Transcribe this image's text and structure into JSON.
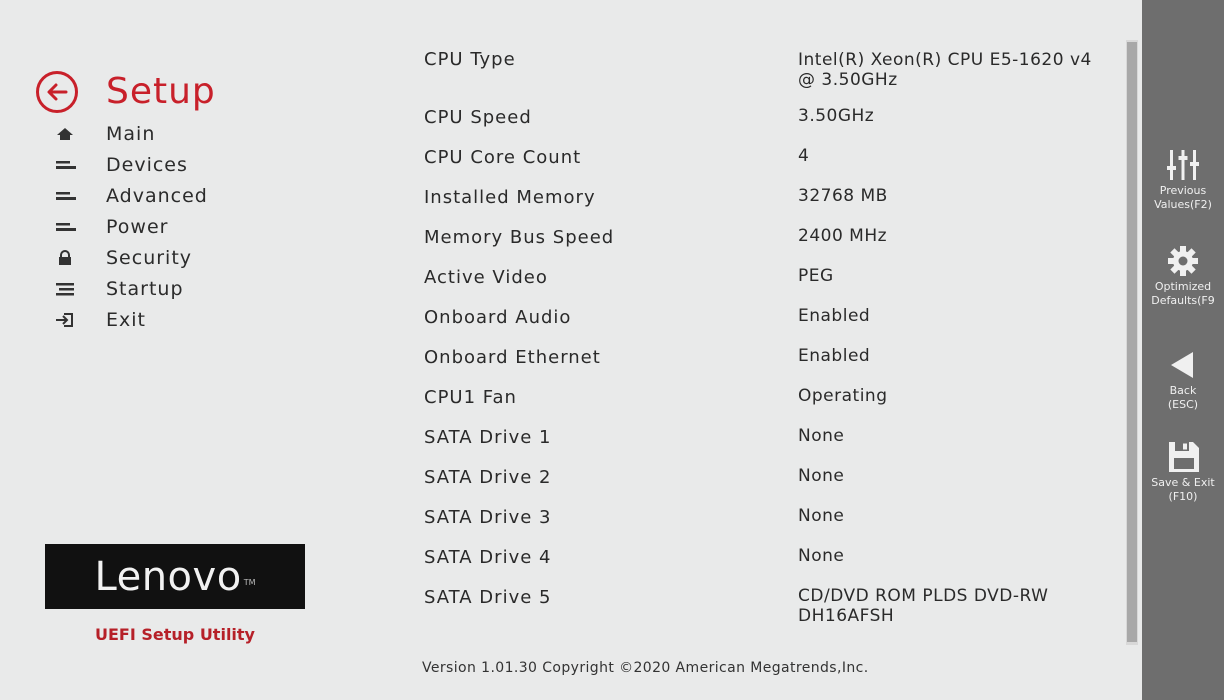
{
  "header": {
    "title": "Setup"
  },
  "nav": {
    "items": [
      {
        "label": "Main",
        "icon": "home-icon"
      },
      {
        "label": "Devices",
        "icon": "menu-lines-icon"
      },
      {
        "label": "Advanced",
        "icon": "menu-lines-icon"
      },
      {
        "label": "Power",
        "icon": "menu-lines-icon"
      },
      {
        "label": "Security",
        "icon": "lock-icon"
      },
      {
        "label": "Startup",
        "icon": "startup-icon"
      },
      {
        "label": "Exit",
        "icon": "exit-icon"
      }
    ]
  },
  "branding": {
    "logo": "Lenovo",
    "tm": "TM",
    "utility": "UEFI Setup Utility"
  },
  "info": {
    "rows": [
      {
        "key": "CPU Type",
        "value": "Intel(R) Xeon(R) CPU E5-1620 v4 @ 3.50GHz"
      },
      {
        "key": "CPU Speed",
        "value": "3.50GHz"
      },
      {
        "key": "CPU Core Count",
        "value": "4"
      },
      {
        "key": "Installed Memory",
        "value": "32768 MB"
      },
      {
        "key": "Memory Bus Speed",
        "value": "2400 MHz"
      },
      {
        "key": "Active Video",
        "value": "PEG"
      },
      {
        "key": "Onboard Audio",
        "value": "Enabled"
      },
      {
        "key": "Onboard Ethernet",
        "value": "Enabled"
      },
      {
        "key": "CPU1 Fan",
        "value": "Operating"
      },
      {
        "key": "SATA Drive 1",
        "value": "None"
      },
      {
        "key": "SATA Drive 2",
        "value": "None"
      },
      {
        "key": "SATA Drive 3",
        "value": "None"
      },
      {
        "key": "SATA Drive 4",
        "value": "None"
      },
      {
        "key": "SATA Drive 5",
        "value": "CD/DVD ROM PLDS DVD-RW DH16AFSH"
      }
    ]
  },
  "footer": {
    "version": "Version 1.01.30 Copyright ©2020 American Megatrends,Inc."
  },
  "function_bar": {
    "buttons": [
      {
        "line1": "Previous",
        "line2": "Values(F2)",
        "icon": "sliders-icon"
      },
      {
        "line1": "Optimized",
        "line2": "Defaults(F9",
        "icon": "gear-icon"
      },
      {
        "line1": "Back",
        "line2": "(ESC)",
        "icon": "back-triangle-icon"
      },
      {
        "line1": "Save & Exit",
        "line2": "(F10)",
        "icon": "floppy-disk-icon"
      }
    ]
  },
  "colors": {
    "accent": "#c8202a",
    "background": "#e9eaea",
    "sidebar": "#6e6e6e",
    "logo_bg": "#111111"
  }
}
